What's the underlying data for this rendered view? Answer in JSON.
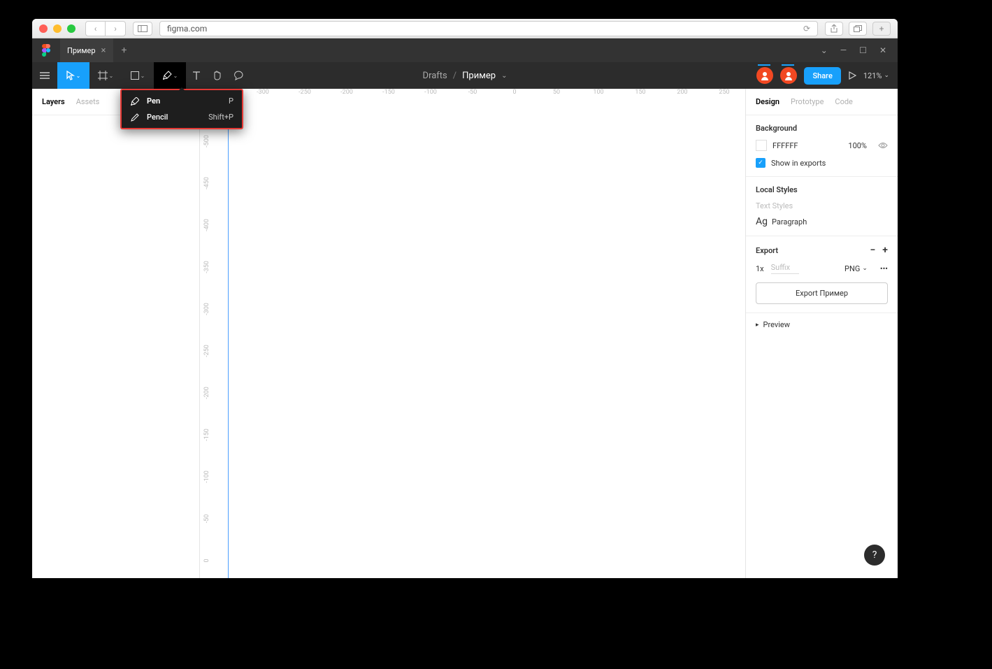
{
  "browser": {
    "url": "figma.com"
  },
  "tabs": {
    "active": "Пример"
  },
  "window_controls": {
    "chevron": "⌄",
    "minimize": "—",
    "maximize": "☐",
    "close": "✕"
  },
  "toolbar": {
    "breadcrumb_root": "Drafts",
    "breadcrumb_name": "Пример",
    "share_label": "Share",
    "zoom_value": "121%"
  },
  "dropdown": {
    "items": [
      {
        "label": "Pen",
        "shortcut": "P",
        "icon": "pen"
      },
      {
        "label": "Pencil",
        "shortcut": "Shift+P",
        "icon": "pencil"
      }
    ]
  },
  "left_panel": {
    "tabs": {
      "layers": "Layers",
      "assets": "Assets"
    }
  },
  "ruler": {
    "h": [
      "-300",
      "-250",
      "-200",
      "-150",
      "-100",
      "-50",
      "0",
      "50",
      "100",
      "150",
      "200",
      "250"
    ],
    "v": [
      "-500",
      "-450",
      "-400",
      "-350",
      "-300",
      "-250",
      "-200",
      "-150",
      "-100",
      "-50",
      "0"
    ]
  },
  "right_panel": {
    "tabs": {
      "design": "Design",
      "prototype": "Prototype",
      "code": "Code"
    },
    "background": {
      "header": "Background",
      "hex": "FFFFFF",
      "opacity": "100%",
      "show_exports": "Show in exports"
    },
    "local_styles": {
      "header": "Local Styles",
      "text_styles_label": "Text Styles",
      "ag": "Ag",
      "paragraph": "Paragraph"
    },
    "export": {
      "header": "Export",
      "scale": "1x",
      "suffix_placeholder": "Suffix",
      "format": "PNG",
      "button": "Export Пример",
      "preview": "Preview"
    }
  },
  "help": "?"
}
